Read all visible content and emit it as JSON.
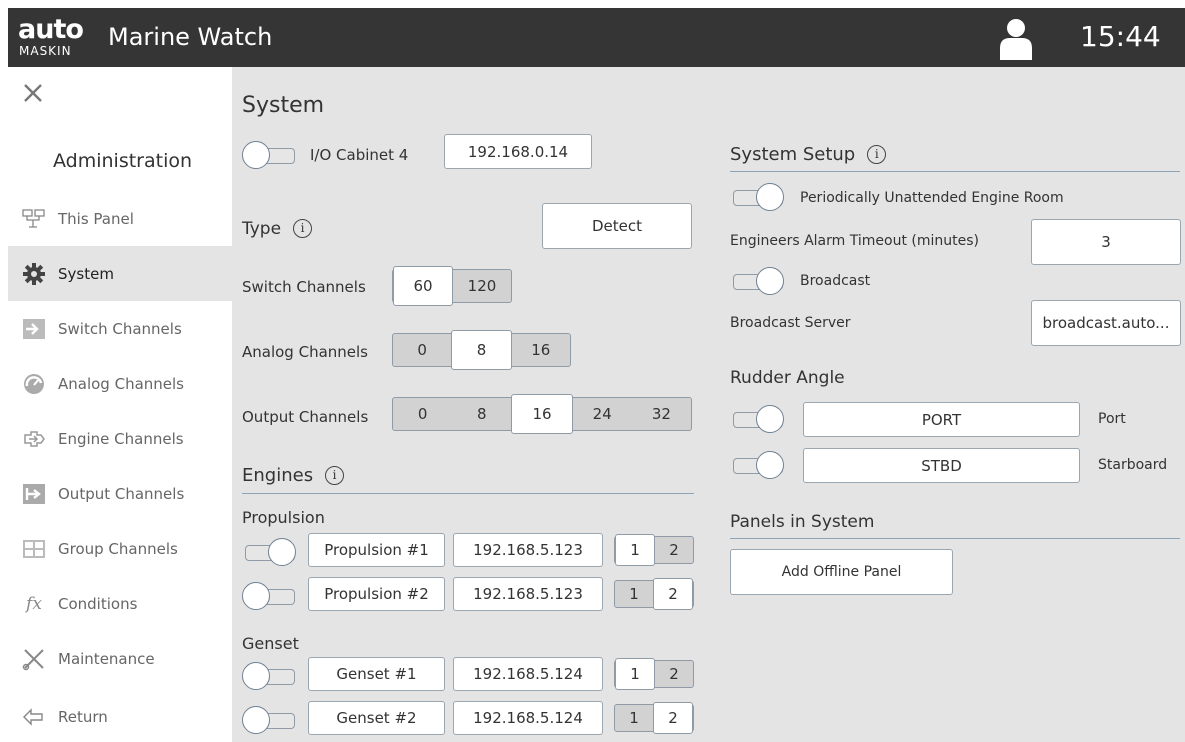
{
  "header": {
    "logo_main": "auto",
    "logo_sub": "MASKIN",
    "app_title": "Marine Watch",
    "clock": "15:44"
  },
  "sidebar": {
    "section_title": "Administration",
    "items": [
      {
        "label": "This Panel",
        "icon": "panel-icon"
      },
      {
        "label": "System",
        "icon": "gear-icon",
        "active": true
      },
      {
        "label": "Switch Channels",
        "icon": "switch-icon"
      },
      {
        "label": "Analog Channels",
        "icon": "gauge-icon"
      },
      {
        "label": "Engine Channels",
        "icon": "engine-icon"
      },
      {
        "label": "Output Channels",
        "icon": "output-icon"
      },
      {
        "label": "Group Channels",
        "icon": "group-icon"
      },
      {
        "label": "Conditions",
        "icon": "function-icon"
      },
      {
        "label": "Maintenance",
        "icon": "tools-icon"
      },
      {
        "label": "Return",
        "icon": "return-icon"
      }
    ]
  },
  "system": {
    "title": "System",
    "cabinet_label": "I/O Cabinet 4",
    "cabinet_ip": "192.168.0.14",
    "type_label": "Type",
    "detect_label": "Detect",
    "switch_channels": {
      "label": "Switch Channels",
      "options": [
        "60",
        "120"
      ],
      "selected": "60"
    },
    "analog_channels": {
      "label": "Analog Channels",
      "options": [
        "0",
        "8",
        "16"
      ],
      "selected": "8"
    },
    "output_channels": {
      "label": "Output Channels",
      "options": [
        "0",
        "8",
        "16",
        "24",
        "32"
      ],
      "selected": "16"
    }
  },
  "engines": {
    "title": "Engines",
    "propulsion_label": "Propulsion",
    "genset_label": "Genset",
    "rows": [
      {
        "name": "Propulsion #1",
        "ip": "192.168.5.123",
        "opt1": "1",
        "opt2": "2",
        "enabled": true,
        "selected": "1"
      },
      {
        "name": "Propulsion #2",
        "ip": "192.168.5.123",
        "opt1": "1",
        "opt2": "2",
        "enabled": false,
        "selected": "2"
      },
      {
        "name": "Genset #1",
        "ip": "192.168.5.124",
        "opt1": "1",
        "opt2": "2",
        "enabled": false,
        "selected": "1"
      },
      {
        "name": "Genset #2",
        "ip": "192.168.5.124",
        "opt1": "1",
        "opt2": "2",
        "enabled": false,
        "selected": "2"
      }
    ]
  },
  "system_setup": {
    "title": "System Setup",
    "unattended_label": "Periodically Unattended Engine Room",
    "unattended_enabled": true,
    "alarm_timeout_label": "Engineers Alarm Timeout (minutes)",
    "alarm_timeout_value": "3",
    "broadcast_label": "Broadcast",
    "broadcast_enabled": true,
    "broadcast_server_label": "Broadcast Server",
    "broadcast_server_value": "broadcast.auto..."
  },
  "rudder": {
    "title": "Rudder Angle",
    "port_value": "PORT",
    "port_label": "Port",
    "port_enabled": true,
    "stbd_value": "STBD",
    "stbd_label": "Starboard",
    "stbd_enabled": true
  },
  "panels": {
    "title": "Panels in System",
    "add_offline_label": "Add Offline Panel"
  }
}
